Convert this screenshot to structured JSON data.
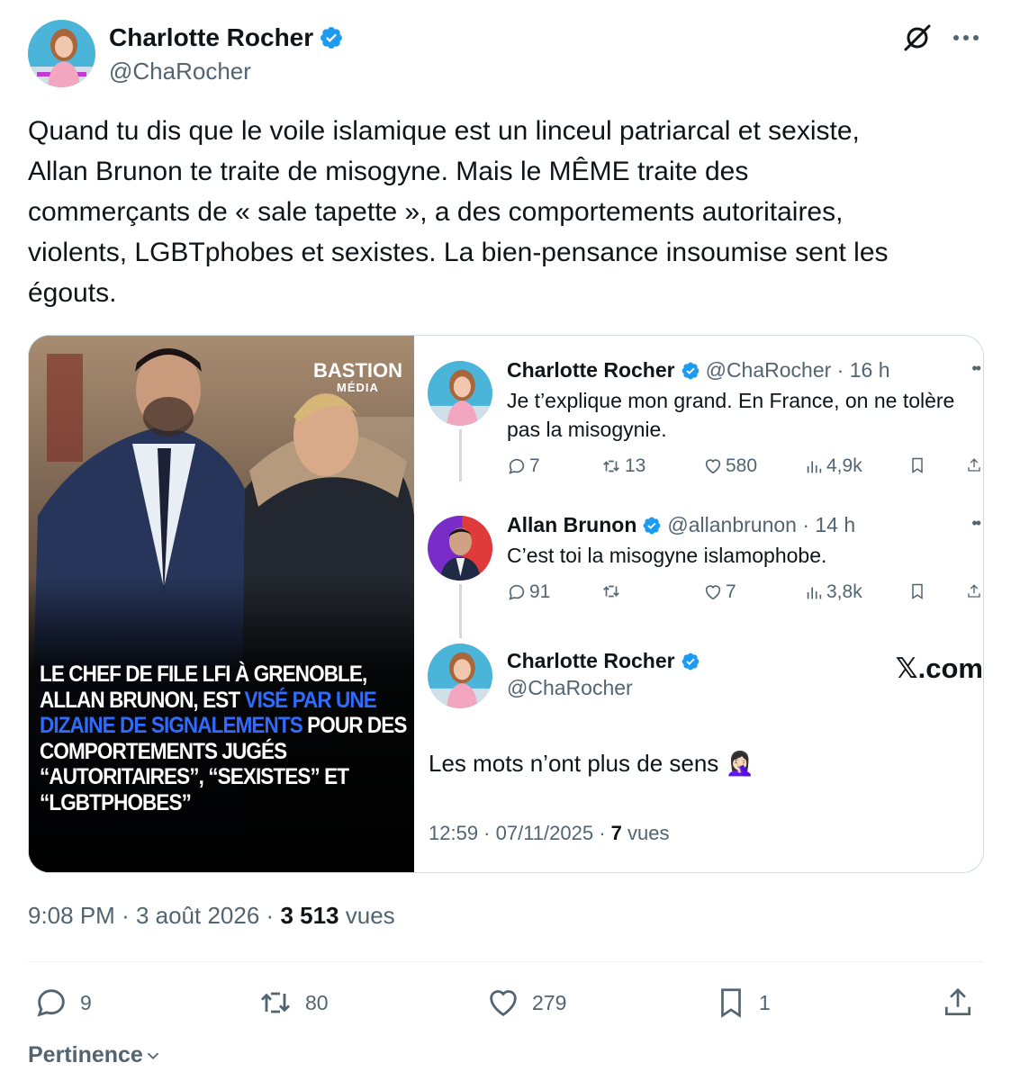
{
  "author": {
    "name": "Charlotte Rocher",
    "handle": "@ChaRocher",
    "verified": true
  },
  "icons": {
    "grok": "grok-icon",
    "more": "more-horizontal-icon"
  },
  "tweet": {
    "text": "Quand tu dis que le voile islamique est un linceul patriarcal et sexiste,\nAllan Brunon te traite de misogyne. Mais le MÊME traite des\ncommerçants de « sale tapette », a des comportements autoritaires,\nviolents, LGBTphobes et sexistes. La bien-pensance insoumise sent les\négouts.",
    "time": "9:08 PM",
    "date": "3 août 2026",
    "views_count": "3 513",
    "views_label": "vues"
  },
  "photo": {
    "watermark_top": "BASTION",
    "watermark_bottom": "MÉDIA",
    "caption_part1": "LE CHEF DE FILE LFI À GRENOBLE, ALLAN BRUNON, EST ",
    "caption_highlight": "VISÉ PAR UNE DIZAINE DE SIGNALEMENTS",
    "caption_part2": " POUR DES COMPORTEMENTS JUGÉS “AUTORITAIRES”, “SEXISTES” ET “LGBTPHOBES”"
  },
  "embedded": {
    "tweet1": {
      "name": "Charlotte Rocher",
      "handle_time": "@ChaRocher · 16 h",
      "text": "Je t’explique mon grand. En France, on ne tolère pas la misogynie.",
      "replies": "7",
      "reposts": "13",
      "likes": "580",
      "views": "4,9k"
    },
    "tweet2": {
      "name": "Allan Brunon",
      "handle_time": "@allanbrunon · 14 h",
      "text": "C’est toi la misogyne islamophobe.",
      "replies": "91",
      "reposts": "",
      "likes": "7",
      "views": "3,8k"
    },
    "tweet3": {
      "name": "Charlotte Rocher",
      "handle": "@ChaRocher",
      "text": "Les mots n’ont plus de sens 🤦🏻‍♀️",
      "time": "12:59 · 07/11/2025 · ",
      "views_count": "7",
      "views_label": " vues"
    },
    "brand": "𝕏.com"
  },
  "actions": {
    "replies": "9",
    "reposts": "80",
    "likes": "279",
    "bookmarks": "1"
  },
  "sort": {
    "label": "Pertinence"
  },
  "colors": {
    "verified": "#1d9bf0",
    "secondary_text": "#536471",
    "highlight_blue": "#2f6bff"
  }
}
